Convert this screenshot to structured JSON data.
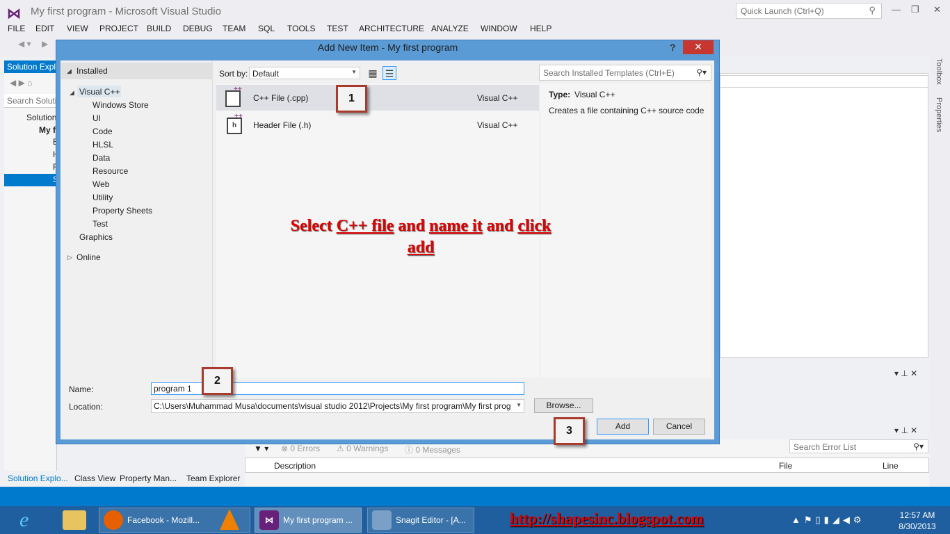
{
  "window": {
    "title": "My first program - Microsoft Visual Studio",
    "quick_launch_placeholder": "Quick Launch (Ctrl+Q)"
  },
  "menu": [
    "FILE",
    "EDIT",
    "VIEW",
    "PROJECT",
    "BUILD",
    "DEBUG",
    "TEAM",
    "SQL",
    "TOOLS",
    "TEST",
    "ARCHITECTURE",
    "ANALYZE",
    "WINDOW",
    "HELP"
  ],
  "solution_explorer": {
    "tab": "Solution Expl",
    "search": "Search Soluti",
    "rows": [
      "Solution",
      "My f",
      "E",
      "H",
      "R",
      "S"
    ]
  },
  "bottom_tabs": [
    "Solution Explo...",
    "Class View",
    "Property Man...",
    "Team Explorer"
  ],
  "right_sidebar": [
    "Toolbox",
    "Properties"
  ],
  "error_list": {
    "errors": "0 Errors",
    "warnings": "0 Warnings",
    "messages": "0 Messages",
    "search": "Search Error List",
    "col_description": "Description",
    "col_file": "File",
    "col_line": "Line"
  },
  "dialog": {
    "title": "Add New Item - My first program",
    "help": "?",
    "close": "✕",
    "tree": {
      "installed": "Installed",
      "visual_cpp": "Visual C++",
      "children": [
        "Windows Store",
        "UI",
        "Code",
        "HLSL",
        "Data",
        "Resource",
        "Web",
        "Utility",
        "Property Sheets",
        "Test"
      ],
      "graphics": "Graphics",
      "online": "Online"
    },
    "sort_label": "Sort by:",
    "sort_value": "Default",
    "search_placeholder": "Search Installed Templates (Ctrl+E)",
    "items": [
      {
        "name": "C++ File (.cpp)",
        "type": "Visual C++",
        "icon": "cpp-file-icon"
      },
      {
        "name": "Header File (.h)",
        "type": "Visual C++",
        "icon": "header-file-icon"
      }
    ],
    "info": {
      "type_label": "Type:",
      "type_value": "Visual C++",
      "description": "Creates a file containing C++ source code"
    },
    "name_label": "Name:",
    "name_value": "program 1",
    "location_label": "Location:",
    "location_value": "C:\\Users\\Muhammad Musa\\documents\\visual studio 2012\\Projects\\My first program\\My first prog",
    "browse": "Browse...",
    "add": "Add",
    "cancel": "Cancel"
  },
  "annotations": {
    "callout1": "1",
    "callout2": "2",
    "callout3": "3",
    "instruction_a": "Select ",
    "instruction_b": "C++ file",
    "instruction_c": " and ",
    "instruction_d": "name it",
    "instruction_e": " and ",
    "instruction_f": "click",
    "instruction_g": "add"
  },
  "taskbar": {
    "items": [
      "Facebook - Mozill...",
      "My first program ...",
      "Snagit Editor - [A..."
    ],
    "url": "http://shapesinc.blogspot.com",
    "time": "12:57 AM",
    "date": "8/30/2013"
  },
  "colors": {
    "vs_accent": "#007acc",
    "dialog_frame": "#5b9bd5",
    "annotation_red": "#e00000",
    "callout_border": "#a83a2e"
  }
}
